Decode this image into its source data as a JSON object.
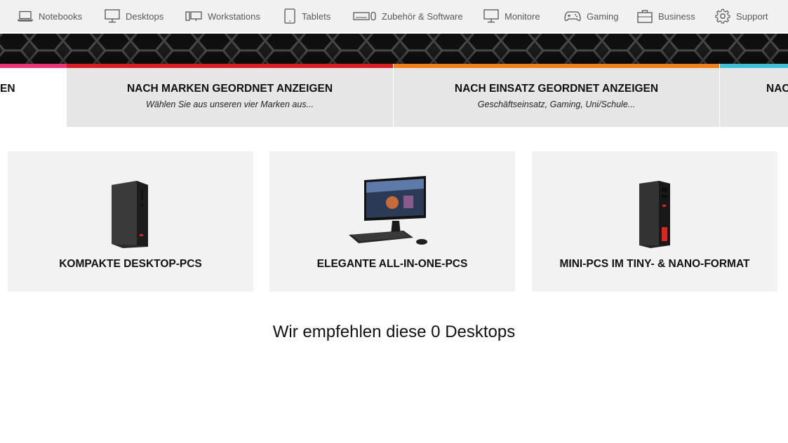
{
  "nav": {
    "items": [
      {
        "label": "Notebooks",
        "icon": "laptop-icon"
      },
      {
        "label": "Desktops",
        "icon": "monitor-tower-icon"
      },
      {
        "label": "Workstations",
        "icon": "workstation-icon"
      },
      {
        "label": "Tablets",
        "icon": "tablet-icon"
      },
      {
        "label": "Zubehör & Software",
        "icon": "keyboard-icon"
      },
      {
        "label": "Monitore",
        "icon": "monitor-icon"
      },
      {
        "label": "Gaming",
        "icon": "gamepad-icon"
      },
      {
        "label": "Business",
        "icon": "briefcase-icon"
      },
      {
        "label": "Support",
        "icon": "gear-icon"
      }
    ]
  },
  "tabs": [
    {
      "title": "EN",
      "subtitle": "",
      "color": "#e8357a"
    },
    {
      "title": "NACH MARKEN GEORDNET ANZEIGEN",
      "subtitle": "Wählen Sie aus unseren vier Marken aus...",
      "color": "#d91f26"
    },
    {
      "title": "NACH EINSATZ GEORDNET ANZEIGEN",
      "subtitle": "Geschäftseinsatz, Gaming, Uni/Schule...",
      "color": "#f07e1b"
    },
    {
      "title": "NAC",
      "subtitle": "",
      "color": "#3cc1d8"
    }
  ],
  "cards": [
    {
      "label": "KOMPAKTE DESKTOP-PCS",
      "image": "compact-desktop-tower"
    },
    {
      "label": "ELEGANTE ALL-IN-ONE-PCS",
      "image": "all-in-one-pc"
    },
    {
      "label": "MINI-PCS IM TINY- & NANO-FORMAT",
      "image": "mini-pc"
    }
  ],
  "recommendation": {
    "text": "Wir empfehlen diese 0 Desktops"
  },
  "colors": {
    "accent_red": "#e2231a",
    "nav_bg": "#f1f1f1",
    "card_bg": "#f2f2f2",
    "tab_bg": "#e6e6e6"
  }
}
